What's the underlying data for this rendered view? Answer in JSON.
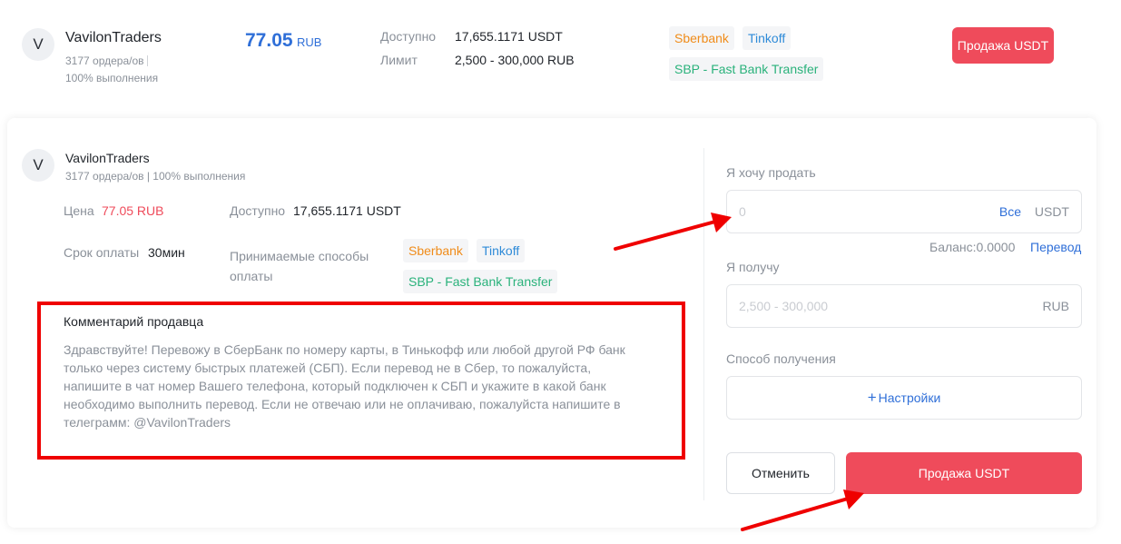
{
  "listing": {
    "avatar_letter": "V",
    "merchant_name": "VavilonTraders",
    "orders": "3177 ордера/ов",
    "completion": "100% выполнения",
    "price_value": "77.05",
    "price_currency": "RUB",
    "available_label": "Доступно",
    "available_value": "17,655.1171 USDT",
    "limit_label": "Лимит",
    "limit_value": "2,500 - 300,000 RUB",
    "methods": [
      "Sberbank",
      "Tinkoff",
      "SBP - Fast Bank Transfer"
    ],
    "sell_button": "Продажа USDT"
  },
  "order": {
    "avatar_letter": "V",
    "merchant_name": "VavilonTraders",
    "stats": "3177 ордера/ов | 100% выполнения",
    "price_label": "Цена",
    "price_value": "77.05 RUB",
    "available_label": "Доступно",
    "available_value": "17,655.1171 USDT",
    "term_label": "Срок оплаты",
    "term_value": "30мин",
    "methods_label_line1": "Принимаемые способы",
    "methods_label_line2": "оплаты",
    "methods": [
      "Sberbank",
      "Tinkoff",
      "SBP - Fast Bank Transfer"
    ],
    "comment_title": "Комментарий продавца",
    "comment_lines": [
      "Здравствуйте! Перевожу в СберБанк по номеру карты, в Тинькофф или любой другой РФ банк",
      "только через систему быстрых платежей (СБП). Если перевод не в Сбер, то пожалуйста,",
      "напишите в чат номер Вашего телефона, который подключен к СБП и укажите в какой банк",
      "необходимо выполнить перевод. Если не отвечаю или не оплачиваю, пожалуйста напишите в",
      "телеграмм: @VavilonTraders"
    ]
  },
  "form": {
    "sell_label": "Я хочу продать",
    "sell_placeholder": "0",
    "sell_all": "Все",
    "sell_currency": "USDT",
    "balance_text": "Баланс:0.0000",
    "transfer_link": "Перевод",
    "receive_label": "Я получу",
    "receive_placeholder": "2,500 - 300,000",
    "receive_currency": "RUB",
    "method_label": "Способ получения",
    "settings_plus": "+",
    "settings_button": "Настройки",
    "cancel_button": "Отменить",
    "submit_button": "Продажа USDT"
  },
  "colors": {
    "accent_red": "#ef4b5b",
    "price_blue": "#2f6fd8",
    "highlight_red": "#ef0000"
  }
}
